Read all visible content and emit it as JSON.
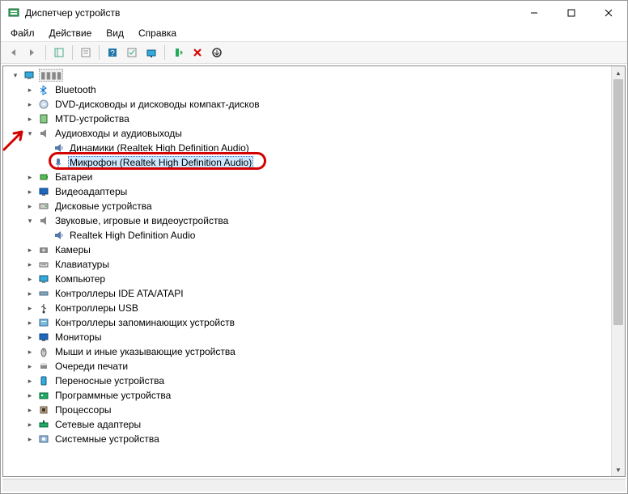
{
  "window": {
    "title": "Диспетчер устройств"
  },
  "menu": {
    "file": "Файл",
    "action": "Действие",
    "view": "Вид",
    "help": "Справка"
  },
  "tree": {
    "root": "",
    "items": [
      {
        "label": "Bluetooth",
        "expand": "closed",
        "icon": "bluetooth"
      },
      {
        "label": "DVD-дисководы и дисководы компакт-дисков",
        "expand": "closed",
        "icon": "dvd"
      },
      {
        "label": "MTD-устройства",
        "expand": "closed",
        "icon": "mtd"
      },
      {
        "label": "Аудиовходы и аудиовыходы",
        "expand": "open",
        "icon": "audio",
        "children": [
          {
            "label": "Динамики (Realtek High Definition Audio)",
            "icon": "speaker"
          },
          {
            "label": "Микрофон (Realtek High Definition Audio)",
            "icon": "mic",
            "selected": true,
            "highlighted": true
          }
        ]
      },
      {
        "label": "Батареи",
        "expand": "closed",
        "icon": "battery"
      },
      {
        "label": "Видеоадаптеры",
        "expand": "closed",
        "icon": "display-adapter"
      },
      {
        "label": "Дисковые устройства",
        "expand": "closed",
        "icon": "disk"
      },
      {
        "label": "Звуковые, игровые и видеоустройства",
        "expand": "open",
        "icon": "audio",
        "children": [
          {
            "label": "Realtek High Definition Audio",
            "icon": "speaker"
          }
        ]
      },
      {
        "label": "Камеры",
        "expand": "closed",
        "icon": "camera"
      },
      {
        "label": "Клавиатуры",
        "expand": "closed",
        "icon": "keyboard"
      },
      {
        "label": "Компьютер",
        "expand": "closed",
        "icon": "pc"
      },
      {
        "label": "Контроллеры IDE ATA/ATAPI",
        "expand": "closed",
        "icon": "ide"
      },
      {
        "label": "Контроллеры USB",
        "expand": "closed",
        "icon": "usb"
      },
      {
        "label": "Контроллеры запоминающих устройств",
        "expand": "closed",
        "icon": "storage-ctrl"
      },
      {
        "label": "Мониторы",
        "expand": "closed",
        "icon": "monitor"
      },
      {
        "label": "Мыши и иные указывающие устройства",
        "expand": "closed",
        "icon": "mouse"
      },
      {
        "label": "Очереди печати",
        "expand": "closed",
        "icon": "printer"
      },
      {
        "label": "Переносные устройства",
        "expand": "closed",
        "icon": "portable"
      },
      {
        "label": "Программные устройства",
        "expand": "closed",
        "icon": "software"
      },
      {
        "label": "Процессоры",
        "expand": "closed",
        "icon": "cpu"
      },
      {
        "label": "Сетевые адаптеры",
        "expand": "closed",
        "icon": "network"
      },
      {
        "label": "Системные устройства",
        "expand": "closed",
        "icon": "system"
      }
    ]
  }
}
